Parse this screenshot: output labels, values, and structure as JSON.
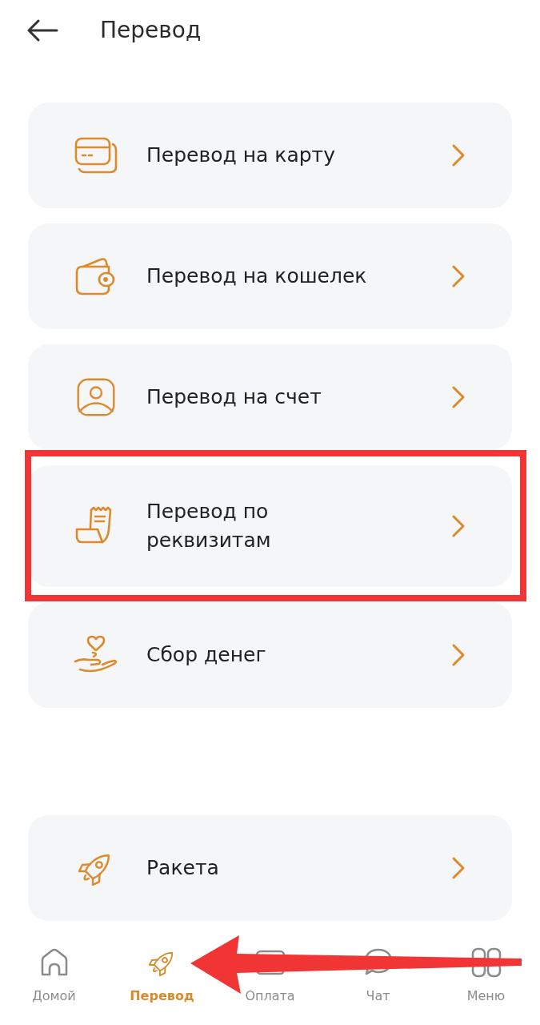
{
  "header": {
    "title": "Перевод"
  },
  "items": [
    {
      "label": "Перевод на карту",
      "highlighted": false
    },
    {
      "label": "Перевод на кошелек",
      "highlighted": false
    },
    {
      "label": "Перевод на счет",
      "highlighted": false
    },
    {
      "label": "Перевод по\nреквизитам",
      "highlighted": true
    },
    {
      "label": "Сбор денег",
      "highlighted": false
    }
  ],
  "extra_items": [
    {
      "label": "Ракета"
    }
  ],
  "nav": [
    {
      "label": "Домой",
      "selected": false,
      "pointed_at": false
    },
    {
      "label": "Перевод",
      "selected": true,
      "pointed_at": true
    },
    {
      "label": "Оплата",
      "selected": false,
      "pointed_at": false
    },
    {
      "label": "Чат",
      "selected": false,
      "pointed_at": false
    },
    {
      "label": "Меню",
      "selected": false,
      "pointed_at": false
    }
  ]
}
